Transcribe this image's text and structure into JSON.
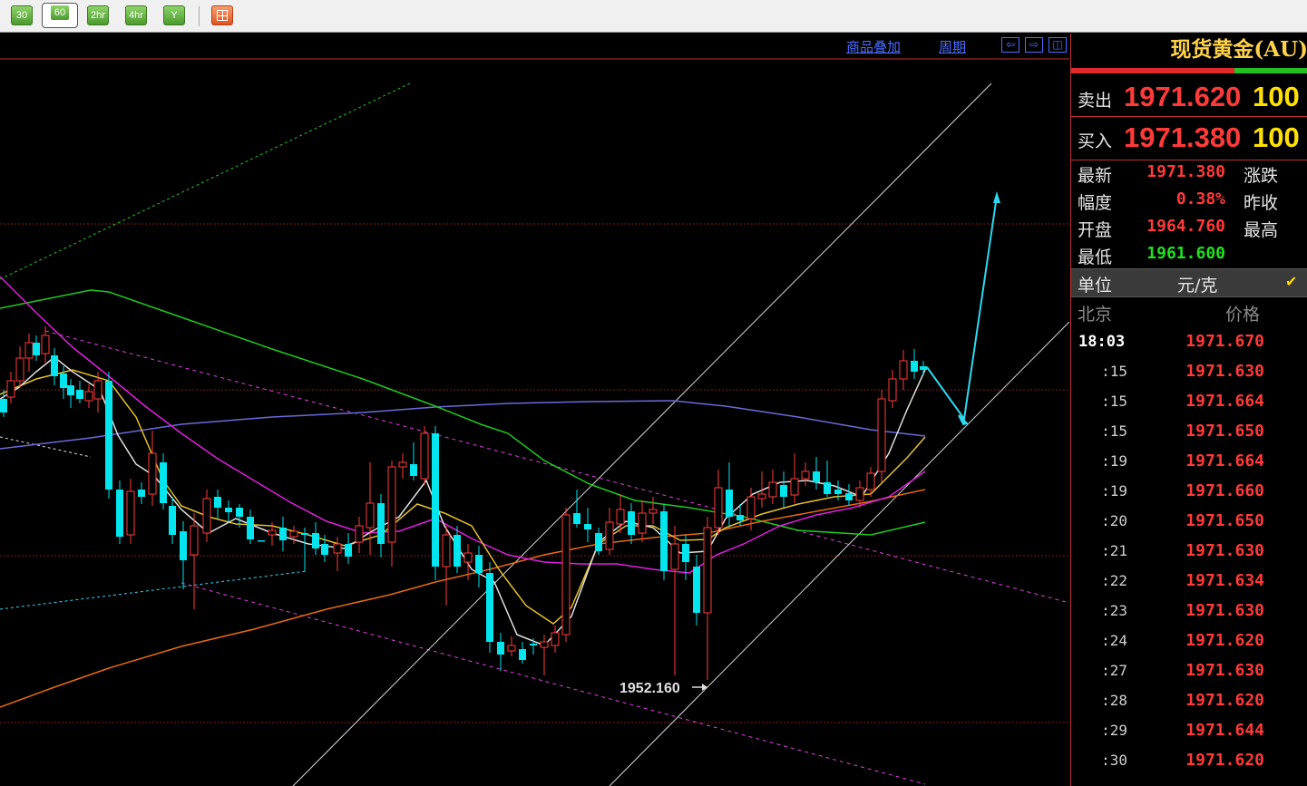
{
  "toolbar": {
    "periods": [
      "30",
      "60",
      "2hr",
      "4hr",
      "Y"
    ],
    "active_period": "60",
    "colors": {
      "button": "#5aa73a",
      "grid_button": "#e8622a"
    }
  },
  "chart": {
    "links": {
      "overlay": "商品叠加",
      "period": "周期"
    },
    "nav_icons": [
      "arrow-left-icon",
      "arrow-right-icon",
      "panel-toggle-icon"
    ],
    "low_marker": "1952.160",
    "colors": {
      "up_candle": "#ff3b3b",
      "down_candle": "#00e5ee",
      "ma_white": "#e0e0e0",
      "ma_yellow": "#e4c02a",
      "ma_magenta": "#e020e0",
      "ma_green": "#1fc81f",
      "ma_blue": "#6a6adc",
      "ma_orange": "#e86a10",
      "grid": "#8a1a1a",
      "channel": "#d8d8d8",
      "trend_dashed": "#e040e0",
      "forecast": "#2ed8f0"
    }
  },
  "panel": {
    "title": "现货黄金(AU)",
    "sell": {
      "label": "卖出",
      "price": "1971.620",
      "volume": "100"
    },
    "buy": {
      "label": "买入",
      "price": "1971.380",
      "volume": "100"
    },
    "stats": [
      {
        "label": "最新",
        "value": "1971.380",
        "color": "#ff3a3a",
        "label2": "涨跌"
      },
      {
        "label": "幅度",
        "value": "0.38%",
        "color": "#ff3a3a",
        "label2": "昨收"
      },
      {
        "label": "开盘",
        "value": "1964.760",
        "color": "#ff3a3a",
        "label2": "最高"
      },
      {
        "label": "最低",
        "value": "1961.600",
        "color": "#22e022",
        "label2": ""
      }
    ],
    "unit_label": "单位",
    "unit_value": "元/克",
    "table_headers": {
      "location": "北京",
      "price": "价格"
    },
    "ticks": [
      {
        "time": "18:03",
        "price": "1971.670"
      },
      {
        "time": ":15",
        "price": "1971.630"
      },
      {
        "time": ":15",
        "price": "1971.664"
      },
      {
        "time": ":15",
        "price": "1971.650"
      },
      {
        "time": ":19",
        "price": "1971.664"
      },
      {
        "time": ":19",
        "price": "1971.660"
      },
      {
        "time": ":20",
        "price": "1971.650"
      },
      {
        "time": ":21",
        "price": "1971.630"
      },
      {
        "time": ":22",
        "price": "1971.634"
      },
      {
        "time": ":23",
        "price": "1971.630"
      },
      {
        "time": ":24",
        "price": "1971.620"
      },
      {
        "time": ":27",
        "price": "1971.630"
      },
      {
        "time": ":28",
        "price": "1971.620"
      },
      {
        "time": ":29",
        "price": "1971.644"
      },
      {
        "time": ":30",
        "price": "1971.620"
      }
    ]
  }
}
